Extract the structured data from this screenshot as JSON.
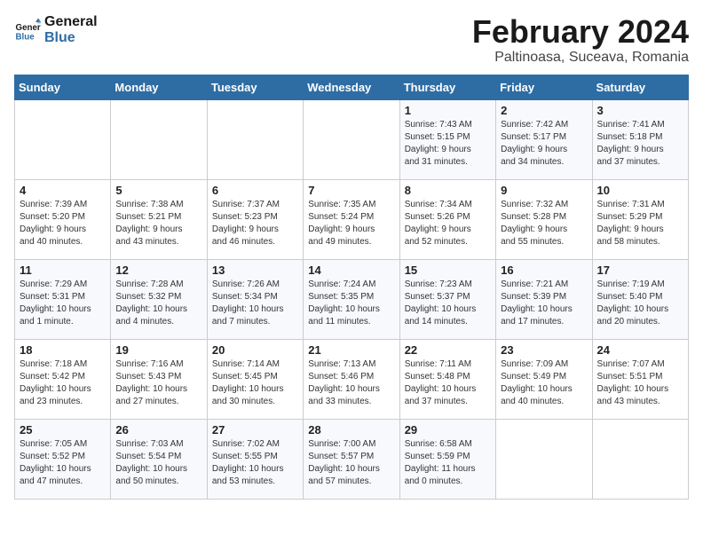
{
  "header": {
    "logo_line1": "General",
    "logo_line2": "Blue",
    "month_title": "February 2024",
    "location": "Paltinoasa, Suceava, Romania"
  },
  "weekdays": [
    "Sunday",
    "Monday",
    "Tuesday",
    "Wednesday",
    "Thursday",
    "Friday",
    "Saturday"
  ],
  "weeks": [
    [
      {
        "day": "",
        "info": ""
      },
      {
        "day": "",
        "info": ""
      },
      {
        "day": "",
        "info": ""
      },
      {
        "day": "",
        "info": ""
      },
      {
        "day": "1",
        "info": "Sunrise: 7:43 AM\nSunset: 5:15 PM\nDaylight: 9 hours\nand 31 minutes."
      },
      {
        "day": "2",
        "info": "Sunrise: 7:42 AM\nSunset: 5:17 PM\nDaylight: 9 hours\nand 34 minutes."
      },
      {
        "day": "3",
        "info": "Sunrise: 7:41 AM\nSunset: 5:18 PM\nDaylight: 9 hours\nand 37 minutes."
      }
    ],
    [
      {
        "day": "4",
        "info": "Sunrise: 7:39 AM\nSunset: 5:20 PM\nDaylight: 9 hours\nand 40 minutes."
      },
      {
        "day": "5",
        "info": "Sunrise: 7:38 AM\nSunset: 5:21 PM\nDaylight: 9 hours\nand 43 minutes."
      },
      {
        "day": "6",
        "info": "Sunrise: 7:37 AM\nSunset: 5:23 PM\nDaylight: 9 hours\nand 46 minutes."
      },
      {
        "day": "7",
        "info": "Sunrise: 7:35 AM\nSunset: 5:24 PM\nDaylight: 9 hours\nand 49 minutes."
      },
      {
        "day": "8",
        "info": "Sunrise: 7:34 AM\nSunset: 5:26 PM\nDaylight: 9 hours\nand 52 minutes."
      },
      {
        "day": "9",
        "info": "Sunrise: 7:32 AM\nSunset: 5:28 PM\nDaylight: 9 hours\nand 55 minutes."
      },
      {
        "day": "10",
        "info": "Sunrise: 7:31 AM\nSunset: 5:29 PM\nDaylight: 9 hours\nand 58 minutes."
      }
    ],
    [
      {
        "day": "11",
        "info": "Sunrise: 7:29 AM\nSunset: 5:31 PM\nDaylight: 10 hours\nand 1 minute."
      },
      {
        "day": "12",
        "info": "Sunrise: 7:28 AM\nSunset: 5:32 PM\nDaylight: 10 hours\nand 4 minutes."
      },
      {
        "day": "13",
        "info": "Sunrise: 7:26 AM\nSunset: 5:34 PM\nDaylight: 10 hours\nand 7 minutes."
      },
      {
        "day": "14",
        "info": "Sunrise: 7:24 AM\nSunset: 5:35 PM\nDaylight: 10 hours\nand 11 minutes."
      },
      {
        "day": "15",
        "info": "Sunrise: 7:23 AM\nSunset: 5:37 PM\nDaylight: 10 hours\nand 14 minutes."
      },
      {
        "day": "16",
        "info": "Sunrise: 7:21 AM\nSunset: 5:39 PM\nDaylight: 10 hours\nand 17 minutes."
      },
      {
        "day": "17",
        "info": "Sunrise: 7:19 AM\nSunset: 5:40 PM\nDaylight: 10 hours\nand 20 minutes."
      }
    ],
    [
      {
        "day": "18",
        "info": "Sunrise: 7:18 AM\nSunset: 5:42 PM\nDaylight: 10 hours\nand 23 minutes."
      },
      {
        "day": "19",
        "info": "Sunrise: 7:16 AM\nSunset: 5:43 PM\nDaylight: 10 hours\nand 27 minutes."
      },
      {
        "day": "20",
        "info": "Sunrise: 7:14 AM\nSunset: 5:45 PM\nDaylight: 10 hours\nand 30 minutes."
      },
      {
        "day": "21",
        "info": "Sunrise: 7:13 AM\nSunset: 5:46 PM\nDaylight: 10 hours\nand 33 minutes."
      },
      {
        "day": "22",
        "info": "Sunrise: 7:11 AM\nSunset: 5:48 PM\nDaylight: 10 hours\nand 37 minutes."
      },
      {
        "day": "23",
        "info": "Sunrise: 7:09 AM\nSunset: 5:49 PM\nDaylight: 10 hours\nand 40 minutes."
      },
      {
        "day": "24",
        "info": "Sunrise: 7:07 AM\nSunset: 5:51 PM\nDaylight: 10 hours\nand 43 minutes."
      }
    ],
    [
      {
        "day": "25",
        "info": "Sunrise: 7:05 AM\nSunset: 5:52 PM\nDaylight: 10 hours\nand 47 minutes."
      },
      {
        "day": "26",
        "info": "Sunrise: 7:03 AM\nSunset: 5:54 PM\nDaylight: 10 hours\nand 50 minutes."
      },
      {
        "day": "27",
        "info": "Sunrise: 7:02 AM\nSunset: 5:55 PM\nDaylight: 10 hours\nand 53 minutes."
      },
      {
        "day": "28",
        "info": "Sunrise: 7:00 AM\nSunset: 5:57 PM\nDaylight: 10 hours\nand 57 minutes."
      },
      {
        "day": "29",
        "info": "Sunrise: 6:58 AM\nSunset: 5:59 PM\nDaylight: 11 hours\nand 0 minutes."
      },
      {
        "day": "",
        "info": ""
      },
      {
        "day": "",
        "info": ""
      }
    ]
  ]
}
